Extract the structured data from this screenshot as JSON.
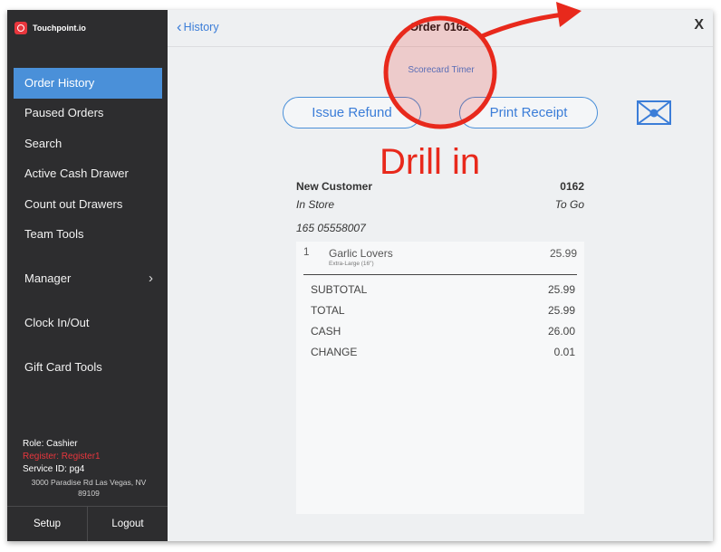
{
  "app": {
    "brand_name": "Touchpoint.io"
  },
  "sidebar": {
    "items": [
      {
        "label": "Order History",
        "active": true
      },
      {
        "label": "Paused Orders"
      },
      {
        "label": "Search"
      },
      {
        "label": "Active Cash Drawer"
      },
      {
        "label": "Count out Drawers"
      },
      {
        "label": "Team Tools"
      },
      {
        "label": "Manager",
        "chevron": "chevron-right-icon"
      },
      {
        "label": "Clock In/Out"
      },
      {
        "label": "Gift Card Tools"
      }
    ],
    "role": "Role: Cashier",
    "register": "Register: Register1",
    "service_id": "Service ID: pg4",
    "address": "3000 Paradise Rd  Las Vegas, NV  89109",
    "setup_label": "Setup",
    "logout_label": "Logout"
  },
  "header": {
    "back_label": "History",
    "title": "Order 0162",
    "close_label": "X"
  },
  "scorecard_timer": "Scorecard Timer",
  "actions": {
    "refund_label": "Issue Refund",
    "print_label": "Print Receipt",
    "email_icon": "envelope-icon"
  },
  "annotation": {
    "text": "Drill in",
    "color": "#e8291c"
  },
  "order": {
    "customer": "New Customer",
    "number": "0162",
    "location": "In Store",
    "mode": "To Go",
    "phone": "165 05558007",
    "items": [
      {
        "qty": "1",
        "name": "Garlic Lovers",
        "size": "Extra-Large (16\")",
        "price": "25.99"
      }
    ],
    "totals": [
      {
        "label": "SUBTOTAL",
        "value": "25.99"
      },
      {
        "label": "TOTAL",
        "value": "25.99"
      },
      {
        "label": "CASH",
        "value": "26.00"
      },
      {
        "label": "CHANGE",
        "value": "0.01"
      }
    ]
  },
  "colors": {
    "accent": "#4a90d9",
    "brand": "#e8363d",
    "sidebar": "#2d2d2f",
    "annotation": "#e8291c"
  }
}
